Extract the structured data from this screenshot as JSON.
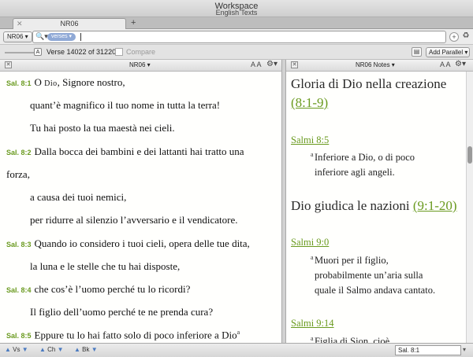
{
  "window": {
    "title": "Workspace",
    "subtitle": "English Texts"
  },
  "tabs": [
    {
      "label": "NR06"
    }
  ],
  "search": {
    "module": "NR06 ▾",
    "token": "verses ▾"
  },
  "versebar": {
    "font_size_label": "A",
    "verse_count": "Verse 14022 of 31220",
    "compare_label": "Compare",
    "add_parallel_label": "Add Parallel ▾"
  },
  "left_pane": {
    "title": "NR06 ▾",
    "aa": "A A",
    "lines": [
      {
        "ref": "Sal. 8:1",
        "pre": "O ",
        "sc": "Dio",
        "post": ", Signore nostro,"
      },
      {
        "text": "quant’è magnifico il tuo nome in tutta la terra!"
      },
      {
        "text": "Tu hai posto la tua maestà nei cieli."
      },
      {
        "ref": "Sal. 8:2",
        "text": "Dalla bocca dei bambini e dei lattanti hai tratto una"
      },
      {
        "text": "forza,"
      },
      {
        "text": "a causa dei tuoi nemici,"
      },
      {
        "text": "per ridurre al silenzio l’avversario e il vendicatore."
      },
      {
        "ref": "Sal. 8:3",
        "text": "Quando io considero i tuoi cieli, opera delle tue dita,"
      },
      {
        "text": "la luna e le stelle che tu hai disposte,"
      },
      {
        "ref": "Sal. 8:4",
        "text": "che cos’è l’uomo perché tu lo ricordi?"
      },
      {
        "text": "Il figlio dell’uomo perché te ne prenda cura?"
      },
      {
        "ref": "Sal. 8:5",
        "text": "Eppure tu lo hai fatto solo di poco inferiore a Dio",
        "sup": "a"
      }
    ]
  },
  "right_pane": {
    "title": "NR06 Notes ▾",
    "aa": "A A",
    "heading1": "Gloria di Dio nella creazione",
    "heading1_link": "(8:1-9)",
    "note1_ref": "Salmi 8:5",
    "note1_mark": "a",
    "note1_lines": [
      "Inferiore a Dio, o di poco",
      "inferiore agli angeli."
    ],
    "heading2": "Dio giudica le nazioni",
    "heading2_link": "(9:1-20)",
    "note2_ref": "Salmi 9:0",
    "note2_mark": "a",
    "note2_lines": [
      "Muori per il figlio,",
      "probabilmente un’aria sulla",
      "quale il Salmo andava cantato."
    ],
    "note3_ref": "Salmi 9:14",
    "note3_mark": "a",
    "note3_lines": [
      "Figlia di Sion, cioè"
    ]
  },
  "bottombar": {
    "vs": "Vs",
    "ch": "Ch",
    "bk": "Bk",
    "reference": "Sal. 8:1"
  }
}
